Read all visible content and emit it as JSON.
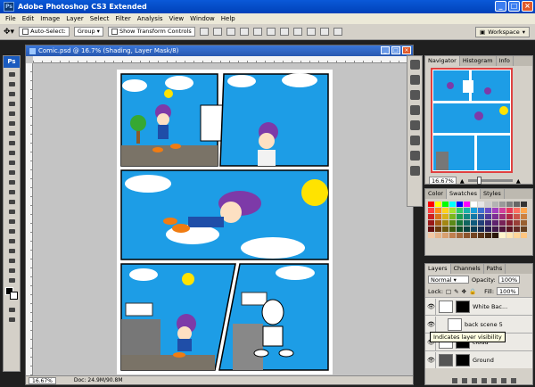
{
  "app": {
    "title": "Adobe Photoshop CS3 Extended",
    "logo": "Ps"
  },
  "menu": [
    "File",
    "Edit",
    "Image",
    "Layer",
    "Select",
    "Filter",
    "Analysis",
    "View",
    "Window",
    "Help"
  ],
  "options": {
    "auto_select_label": "Auto-Select:",
    "auto_select_value": "Group",
    "transform_label": "Show Transform Controls",
    "workspace_label": "Workspace"
  },
  "document": {
    "title": "Comic.psd @ 16.7% (Shading, Layer Mask/8)",
    "zoom": "16.67%",
    "doc_size": "Doc: 24.9M/90.8M"
  },
  "navigator": {
    "tabs": [
      "Navigator",
      "Histogram",
      "Info"
    ],
    "zoom": "16.67%"
  },
  "swatches": {
    "tabs": [
      "Color",
      "Swatches",
      "Styles"
    ],
    "colors": [
      "#ff0000",
      "#ffff00",
      "#00ff00",
      "#00ffff",
      "#0000ff",
      "#ff00ff",
      "#ffffff",
      "#e6e6e6",
      "#cccccc",
      "#b3b3b3",
      "#999999",
      "#808080",
      "#666666",
      "#333333",
      "#ff4040",
      "#ff8c1a",
      "#ffd11a",
      "#a6e22e",
      "#33cc66",
      "#1ab2a8",
      "#1a9fd9",
      "#3d6fd1",
      "#6a4bc6",
      "#a23fbf",
      "#d13f9a",
      "#e6395a",
      "#ff6f61",
      "#ffa64d",
      "#cc2020",
      "#d9731a",
      "#d9b21a",
      "#79b81f",
      "#1f9e4d",
      "#14877f",
      "#1478a6",
      "#2d54a3",
      "#4f3899",
      "#7d2e93",
      "#a02e76",
      "#b22a44",
      "#cc554a",
      "#cc8040",
      "#991818",
      "#a35713",
      "#a38613",
      "#5a8a17",
      "#177539",
      "#0f655f",
      "#0f5a7d",
      "#22407a",
      "#3b2a73",
      "#5e226e",
      "#782258",
      "#851f33",
      "#993f37",
      "#996030",
      "#661010",
      "#6b390c",
      "#6b580c",
      "#3c5c0f",
      "#0f4e26",
      "#0a433f",
      "#0a3c53",
      "#162b52",
      "#271c4d",
      "#3f1749",
      "#50163b",
      "#591522",
      "#662a25",
      "#664020",
      "#f2c9a6",
      "#e6b48a",
      "#d9a070",
      "#c08050",
      "#a66a3d",
      "#8c552e",
      "#734421",
      "#593418",
      "#402510",
      "#2b180a",
      "#fff5cc",
      "#ffe6b3",
      "#ffd699",
      "#ffc680"
    ]
  },
  "layers": {
    "tabs": [
      "Layers",
      "Channels",
      "Paths"
    ],
    "blend": "Normal",
    "opacity_label": "Opacity:",
    "opacity": "100%",
    "lock_label": "Lock:",
    "fill_label": "Fill:",
    "fill": "100%",
    "items": [
      {
        "name": "White Bac..."
      },
      {
        "name": "back scene 5"
      },
      {
        "name": "cloud"
      },
      {
        "name": "Ground"
      }
    ],
    "tooltip": "Indicates layer visibility"
  }
}
